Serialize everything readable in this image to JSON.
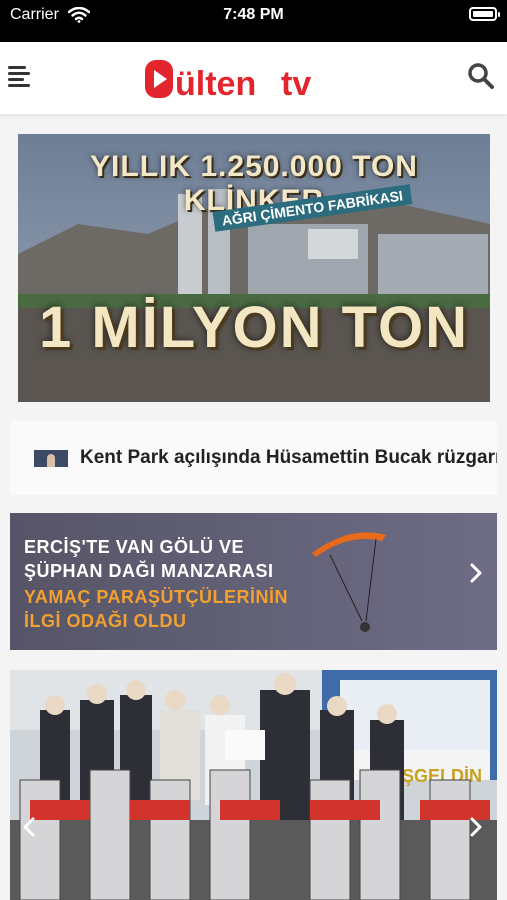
{
  "status_bar": {
    "carrier": "Carrier",
    "time": "7:48 PM"
  },
  "header": {
    "logo": "bültentv",
    "icons": {
      "menu": "menu-icon",
      "search": "search-icon"
    }
  },
  "banner": {
    "headline_top": "YILLIK 1.250.000 TON KLİNKER",
    "sign": "AĞRI ÇİMENTO FABRİKASI",
    "headline_big": "1 MİLYON TON"
  },
  "ticker": {
    "text": "Kent Park açılışında Hüsamettin Bucak rüzgarı"
  },
  "promo": {
    "lines": [
      "ERCİŞ'TE VAN GÖLÜ VE",
      "ŞÜPHAN DAĞI MANZARASI",
      "YAMAÇ PARAŞÜTÇÜLERİNİN",
      "İLGİ ODAĞI OLDU"
    ],
    "colors": {
      "white": "#ffffff",
      "orange": "#f3a030"
    }
  },
  "photo": {
    "sign": "HOŞGELDİN"
  },
  "colors": {
    "brand": "#e3252d",
    "text": "#222222"
  }
}
